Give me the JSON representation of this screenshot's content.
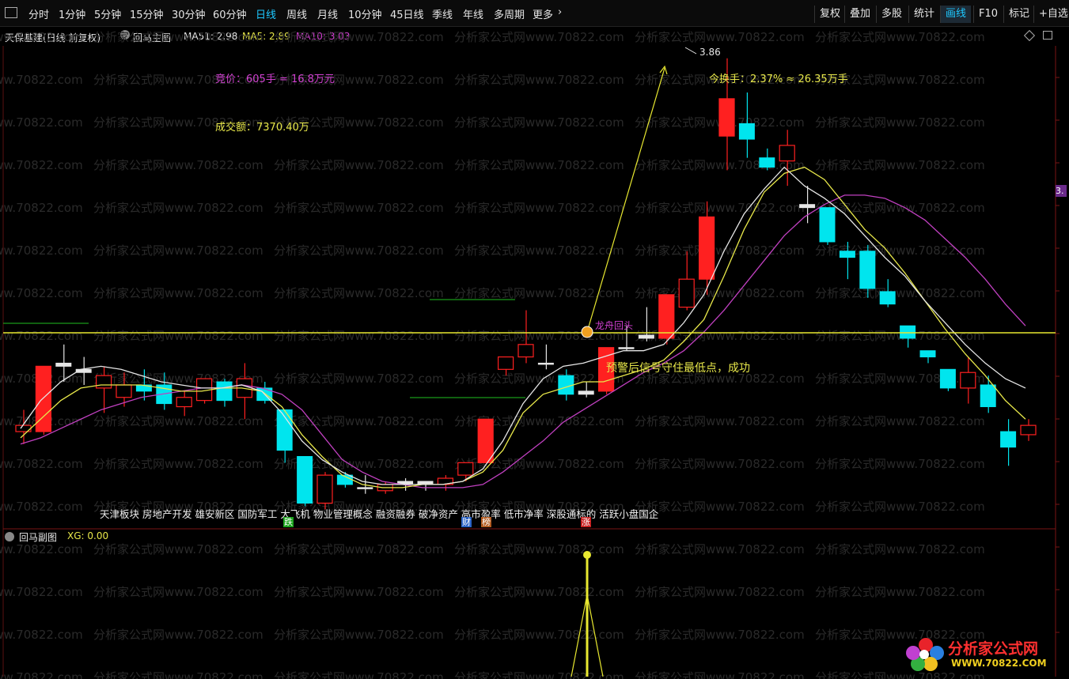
{
  "toolbar": {
    "periods": [
      "分时",
      "1分钟",
      "5分钟",
      "15分钟",
      "30分钟",
      "60分钟",
      "日线",
      "周线",
      "月线",
      "10分钟",
      "45日线",
      "季线",
      "年线",
      "多周期",
      "更多"
    ],
    "active_period": "日线",
    "more_icon": "chevron-right-icon",
    "right_buttons": [
      "复权",
      "叠加",
      "多股",
      "统计",
      "画线",
      "F10",
      "标记",
      "+自选"
    ],
    "active_right": "画线"
  },
  "header": {
    "stock_name": "天保基建(日线 前复权)",
    "indicator_name": "回马主图",
    "ma51": "MA51: 2.98",
    "ma5": "MA5: 2.89",
    "ma10": "MA10: 3.03"
  },
  "annotations": {
    "bid": "竞价：605手 = 16.8万元",
    "turnover_amount": "成交额：7370.40万",
    "turnover_rate": "今换手：2.37% ≈ 26.35万手",
    "high_price": "3.86",
    "signal_label": "龙舟回头",
    "comment": "预警后信号守住最低点，成功",
    "sectors": "天津板块 房地产开发 雄安新区 国防军工 大飞机 物业管理概念 融资融券 破净资产 高市盈率 低市净率 深股通标的 活跃小盘国企"
  },
  "badges": [
    {
      "text": "跌",
      "color": "#1aa31a"
    },
    {
      "text": "财",
      "color": "#2a63c7"
    },
    {
      "text": "榜",
      "color": "#b35a1f"
    },
    {
      "text": "涨",
      "color": "#c81e1e"
    }
  ],
  "axis": {
    "right_price_tag": "3."
  },
  "sub_panel": {
    "title": "回马副图",
    "xg": "XG: 0.00"
  },
  "watermark": {
    "repeat_text": "分析家公式网www.70822.com",
    "logo_title": "分析家公式网",
    "logo_url": "WWW.70822.COM"
  },
  "colors": {
    "up": "#ff2020",
    "down": "#00e5ee",
    "ma_white": "#e6e6e6",
    "ma_yellow": "#e8e84a",
    "ma_magenta": "#c040c0",
    "signal_line": "#e8e830",
    "accent": "#1ec8ff"
  },
  "chart_data": {
    "type": "candlestick",
    "price_range": [
      2.35,
      3.9
    ],
    "candles": [
      {
        "o": 2.66,
        "h": 2.73,
        "l": 2.62,
        "c": 2.68
      },
      {
        "o": 2.66,
        "h": 2.87,
        "l": 2.65,
        "c": 2.87
      },
      {
        "o": 2.87,
        "h": 2.94,
        "l": 2.82,
        "c": 2.88
      },
      {
        "o": 2.86,
        "h": 2.9,
        "l": 2.81,
        "c": 2.85
      },
      {
        "o": 2.8,
        "h": 2.87,
        "l": 2.72,
        "c": 2.84
      },
      {
        "o": 2.77,
        "h": 2.85,
        "l": 2.74,
        "c": 2.81
      },
      {
        "o": 2.81,
        "h": 2.86,
        "l": 2.76,
        "c": 2.79
      },
      {
        "o": 2.81,
        "h": 2.85,
        "l": 2.73,
        "c": 2.75
      },
      {
        "o": 2.74,
        "h": 2.79,
        "l": 2.71,
        "c": 2.77
      },
      {
        "o": 2.76,
        "h": 2.83,
        "l": 2.75,
        "c": 2.83
      },
      {
        "o": 2.82,
        "h": 2.83,
        "l": 2.74,
        "c": 2.76
      },
      {
        "o": 2.77,
        "h": 2.88,
        "l": 2.7,
        "c": 2.83
      },
      {
        "o": 2.8,
        "h": 2.82,
        "l": 2.75,
        "c": 2.76
      },
      {
        "o": 2.73,
        "h": 2.73,
        "l": 2.56,
        "c": 2.6
      },
      {
        "o": 2.58,
        "h": 2.58,
        "l": 2.42,
        "c": 2.43
      },
      {
        "o": 2.43,
        "h": 2.53,
        "l": 2.41,
        "c": 2.52
      },
      {
        "o": 2.52,
        "h": 2.53,
        "l": 2.48,
        "c": 2.49
      },
      {
        "o": 2.48,
        "h": 2.52,
        "l": 2.46,
        "c": 2.48
      },
      {
        "o": 2.47,
        "h": 2.5,
        "l": 2.46,
        "c": 2.49
      },
      {
        "o": 2.49,
        "h": 2.51,
        "l": 2.47,
        "c": 2.5
      },
      {
        "o": 2.5,
        "h": 2.5,
        "l": 2.47,
        "c": 2.49
      },
      {
        "o": 2.49,
        "h": 2.52,
        "l": 2.47,
        "c": 2.51
      },
      {
        "o": 2.52,
        "h": 2.56,
        "l": 2.5,
        "c": 2.56
      },
      {
        "o": 2.56,
        "h": 2.7,
        "l": 2.56,
        "c": 2.7
      },
      {
        "o": 2.86,
        "h": 2.9,
        "l": 2.84,
        "c": 2.9
      },
      {
        "o": 2.9,
        "h": 3.05,
        "l": 2.88,
        "c": 2.94
      },
      {
        "o": 2.88,
        "h": 2.94,
        "l": 2.86,
        "c": 2.88
      },
      {
        "o": 2.84,
        "h": 2.86,
        "l": 2.76,
        "c": 2.78
      },
      {
        "o": 2.78,
        "h": 2.82,
        "l": 2.77,
        "c": 2.79
      },
      {
        "o": 2.79,
        "h": 2.93,
        "l": 2.78,
        "c": 2.93
      },
      {
        "o": 2.93,
        "h": 3.0,
        "l": 2.92,
        "c": 2.93
      },
      {
        "o": 2.96,
        "h": 3.06,
        "l": 2.95,
        "c": 2.97
      },
      {
        "o": 2.96,
        "h": 3.09,
        "l": 2.94,
        "c": 3.1
      },
      {
        "o": 3.06,
        "h": 3.24,
        "l": 3.05,
        "c": 3.15
      },
      {
        "o": 3.15,
        "h": 3.4,
        "l": 3.1,
        "c": 3.35
      },
      {
        "o": 3.61,
        "h": 3.86,
        "l": 3.5,
        "c": 3.73
      },
      {
        "o": 3.65,
        "h": 3.75,
        "l": 3.54,
        "c": 3.6
      },
      {
        "o": 3.54,
        "h": 3.57,
        "l": 3.5,
        "c": 3.51
      },
      {
        "o": 3.53,
        "h": 3.63,
        "l": 3.45,
        "c": 3.58
      },
      {
        "o": 3.39,
        "h": 3.45,
        "l": 3.33,
        "c": 3.38
      },
      {
        "o": 3.38,
        "h": 3.38,
        "l": 3.26,
        "c": 3.27
      },
      {
        "o": 3.24,
        "h": 3.27,
        "l": 3.15,
        "c": 3.22
      },
      {
        "o": 3.24,
        "h": 3.26,
        "l": 3.09,
        "c": 3.12
      },
      {
        "o": 3.11,
        "h": 3.15,
        "l": 3.06,
        "c": 3.07
      },
      {
        "o": 3.0,
        "h": 3.0,
        "l": 2.93,
        "c": 2.96
      },
      {
        "o": 2.92,
        "h": 2.92,
        "l": 2.88,
        "c": 2.9
      },
      {
        "o": 2.86,
        "h": 2.86,
        "l": 2.79,
        "c": 2.8
      },
      {
        "o": 2.8,
        "h": 2.9,
        "l": 2.75,
        "c": 2.85
      },
      {
        "o": 2.81,
        "h": 2.84,
        "l": 2.72,
        "c": 2.74
      },
      {
        "o": 2.66,
        "h": 2.7,
        "l": 2.55,
        "c": 2.61
      },
      {
        "o": 2.65,
        "h": 2.7,
        "l": 2.63,
        "c": 2.68
      }
    ],
    "ma_white": [
      2.67,
      2.76,
      2.82,
      2.86,
      2.87,
      2.86,
      2.84,
      2.82,
      2.81,
      2.8,
      2.8,
      2.81,
      2.79,
      2.72,
      2.63,
      2.57,
      2.53,
      2.5,
      2.49,
      2.49,
      2.49,
      2.49,
      2.5,
      2.54,
      2.63,
      2.75,
      2.83,
      2.87,
      2.88,
      2.9,
      2.92,
      2.92,
      2.94,
      3.01,
      3.1,
      3.24,
      3.36,
      3.44,
      3.51,
      3.45,
      3.41,
      3.36,
      3.29,
      3.22,
      3.16,
      3.08,
      3.01,
      2.94,
      2.88,
      2.83,
      2.8
    ],
    "ma_yellow": [
      2.64,
      2.7,
      2.76,
      2.8,
      2.81,
      2.81,
      2.81,
      2.8,
      2.79,
      2.79,
      2.8,
      2.8,
      2.79,
      2.74,
      2.65,
      2.58,
      2.52,
      2.49,
      2.48,
      2.48,
      2.49,
      2.49,
      2.5,
      2.53,
      2.6,
      2.72,
      2.78,
      2.8,
      2.82,
      2.82,
      2.84,
      2.86,
      2.89,
      2.95,
      3.02,
      3.16,
      3.31,
      3.43,
      3.49,
      3.51,
      3.47,
      3.39,
      3.31,
      3.25,
      3.17,
      3.08,
      2.99,
      2.91,
      2.84,
      2.76,
      2.7
    ],
    "ma_magenta": [
      2.62,
      2.64,
      2.67,
      2.7,
      2.73,
      2.75,
      2.77,
      2.78,
      2.79,
      2.8,
      2.8,
      2.81,
      2.8,
      2.78,
      2.73,
      2.65,
      2.57,
      2.53,
      2.5,
      2.49,
      2.48,
      2.48,
      2.48,
      2.49,
      2.53,
      2.58,
      2.63,
      2.69,
      2.73,
      2.77,
      2.81,
      2.85,
      2.88,
      2.92,
      2.98,
      3.05,
      3.13,
      3.21,
      3.29,
      3.35,
      3.39,
      3.42,
      3.42,
      3.41,
      3.38,
      3.34,
      3.28,
      3.22,
      3.15,
      3.07,
      3.0
    ],
    "signal_level": 2.81,
    "xg_signal_index": 29
  }
}
